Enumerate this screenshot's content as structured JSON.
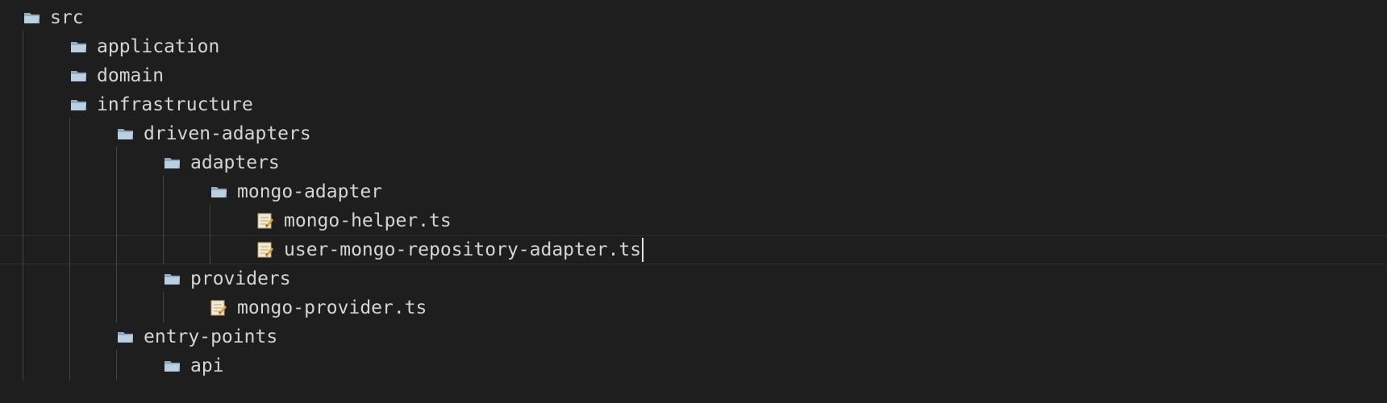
{
  "tree": {
    "items": [
      {
        "label": "src",
        "type": "folder",
        "icon": "folder-icon"
      },
      {
        "label": "application",
        "type": "folder",
        "icon": "folder-icon"
      },
      {
        "label": "domain",
        "type": "folder",
        "icon": "folder-icon"
      },
      {
        "label": "infrastructure",
        "type": "folder",
        "icon": "folder-icon"
      },
      {
        "label": "driven-adapters",
        "type": "folder",
        "icon": "folder-icon"
      },
      {
        "label": "adapters",
        "type": "folder",
        "icon": "folder-icon"
      },
      {
        "label": "mongo-adapter",
        "type": "folder",
        "icon": "folder-icon"
      },
      {
        "label": "mongo-helper.ts",
        "type": "file",
        "icon": "typescript-file-icon"
      },
      {
        "label": "user-mongo-repository-adapter.ts",
        "type": "file",
        "icon": "typescript-file-icon"
      },
      {
        "label": "providers",
        "type": "folder",
        "icon": "folder-icon"
      },
      {
        "label": "mongo-provider.ts",
        "type": "file",
        "icon": "typescript-file-icon"
      },
      {
        "label": "entry-points",
        "type": "folder",
        "icon": "folder-icon"
      },
      {
        "label": "api",
        "type": "folder",
        "icon": "folder-icon"
      }
    ]
  },
  "colors": {
    "background": "#1e1e1e",
    "text": "#d4d4d4",
    "guide": "#444444",
    "folder": "#a9c4d9",
    "file": "#e8d9a8"
  }
}
